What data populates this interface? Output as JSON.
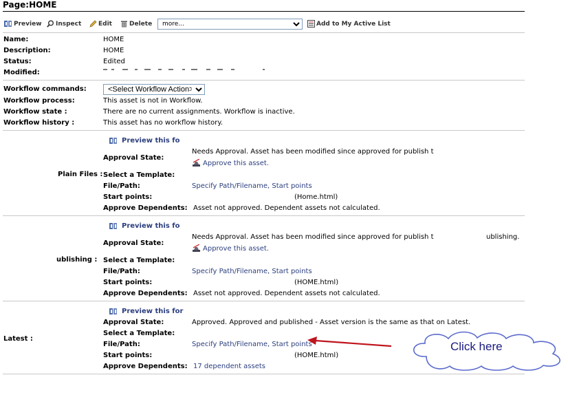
{
  "page": {
    "title": "Page:HOME"
  },
  "toolbar": {
    "preview": "Preview",
    "inspect": "Inspect",
    "edit": "Edit",
    "delete": "Delete",
    "more": "more...",
    "add_active": "Add to My Active List"
  },
  "asset": {
    "name_label": "Name:",
    "name": "HOME",
    "description_label": "Description:",
    "description": "HOME",
    "status_label": "Status:",
    "status": "Edited",
    "modified_label": "Modified:"
  },
  "workflow": {
    "commands_label": "Workflow commands:",
    "select_action": "<Select Workflow Action>",
    "process_label": "Workflow process:",
    "process": "This asset is not in Workflow.",
    "state_label": "Workflow state :",
    "state": "There are no current assignments. Workflow is inactive.",
    "history_label": "Workflow history :",
    "history": "This asset has no workflow history."
  },
  "labels": {
    "approval_state": "Approval State:",
    "select_template": "Select a Template:",
    "file_path": "File/Path:",
    "start_points": "Start points:",
    "approve_dependents": "Approve Dependents:"
  },
  "targets": [
    {
      "label": "Plain Files :",
      "preview": "Preview this fo",
      "approval_state": "Needs Approval. Asset has been modified since approved for publish t",
      "approve_link": "Approve this asset.",
      "file_path": "Specify Path/Filename, Start points",
      "start_points": "(Home.html)",
      "dependents": "Asset not approved. Dependent assets not calculated."
    },
    {
      "label": "ublishing :",
      "preview": "Preview this fo",
      "approval_state": "Needs Approval. Asset has been modified since approved for publish t",
      "approval_tail": "ublishing.",
      "approve_link": "Approve this asset.",
      "file_path": "Specify Path/Filename, Start points",
      "start_points": "(HOME.html)",
      "dependents": "Asset not approved. Dependent assets not calculated."
    },
    {
      "label": "Latest :",
      "preview": "Preview this for",
      "approval_state": "Approved. Approved and published - Asset version is the same as that on Latest.",
      "file_path": "Specify Path/Filename, Start points",
      "start_points": "(HOME.html)",
      "dependents": "17 dependent assets"
    }
  ],
  "callout": {
    "text": "Click here"
  },
  "colors": {
    "link": "#2b3e7e",
    "arrow": "#c0141e",
    "cloud": "#1a1a80"
  }
}
